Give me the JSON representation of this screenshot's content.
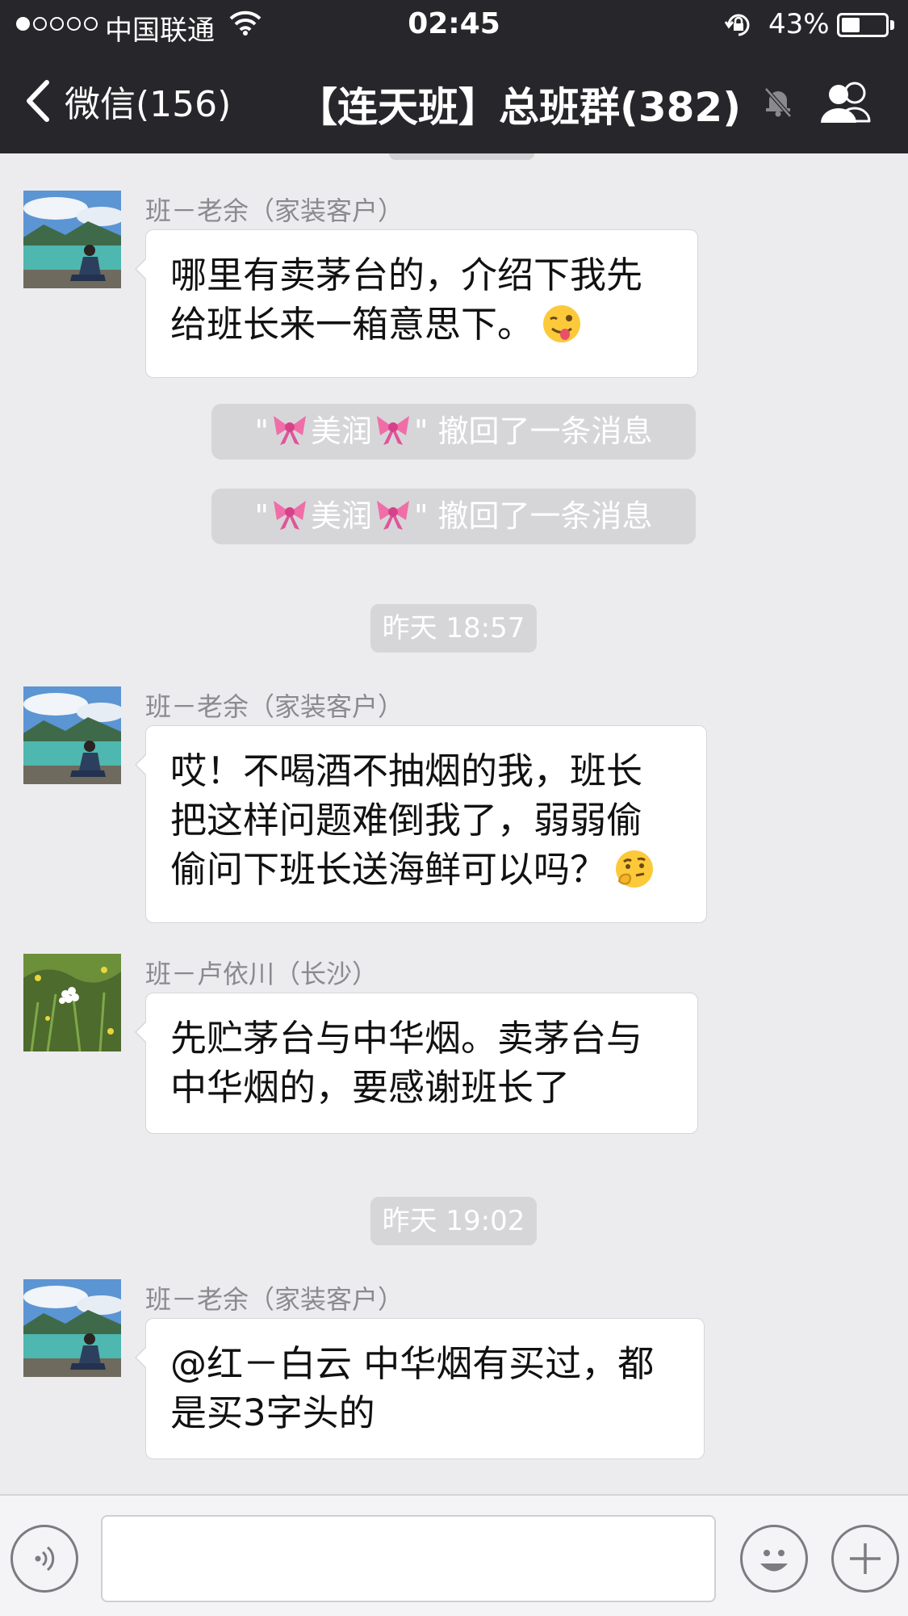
{
  "status_bar": {
    "signal_dots_filled": 1,
    "signal_dots_total": 5,
    "carrier": "中国联通",
    "time": "02:45",
    "battery_percent": "43%",
    "battery_level": 0.43,
    "icons": [
      "signal-dots-icon",
      "wifi-icon",
      "rotation-lock-icon",
      "battery-icon"
    ]
  },
  "nav_bar": {
    "back_label": "微信(156)",
    "title": "【连天班】总班群(382)",
    "icons": [
      "back-chevron-icon",
      "mute-bell-icon",
      "group-members-icon"
    ]
  },
  "chat": {
    "messages": [
      {
        "sender": "班－老余（家装客户）",
        "lines": [
          "哪里有卖茅台的，介绍下我先",
          "给班长来一箱意思下。"
        ],
        "emoji": "winking-tongue-emoji"
      },
      {
        "recall_quote_open": "\"",
        "recall_name": "美润",
        "recall_text": "\" 撤回了一条消息"
      },
      {
        "recall_quote_open": "\"",
        "recall_name": "美润",
        "recall_text": "\" 撤回了一条消息"
      },
      {
        "timestamp": "昨天 18:57"
      },
      {
        "sender": "班－老余（家装客户）",
        "lines": [
          "哎！不喝酒不抽烟的我，班长",
          "把这样问题难倒我了，弱弱偷",
          "偷问下班长送海鲜可以吗？"
        ],
        "emoji": "thinking-face-emoji"
      },
      {
        "sender": "班－卢依川（长沙）",
        "lines": [
          "先贮茅台与中华烟。卖茅台与",
          "中华烟的，要感谢班长了"
        ]
      },
      {
        "timestamp": "昨天 19:02"
      },
      {
        "sender": "班－老余（家装客户）",
        "lines": [
          "@红－白云 中华烟有买过，都",
          "是买3字头的"
        ]
      }
    ]
  },
  "input_bar": {
    "text_value": "",
    "icons": [
      "voice-icon",
      "emoji-smiley-icon",
      "plus-icon"
    ]
  },
  "colors": {
    "nav_background": "#27272b",
    "chat_background": "#ececef",
    "bubble_background": "#ffffff",
    "system_pill": "#d6d6d9"
  }
}
